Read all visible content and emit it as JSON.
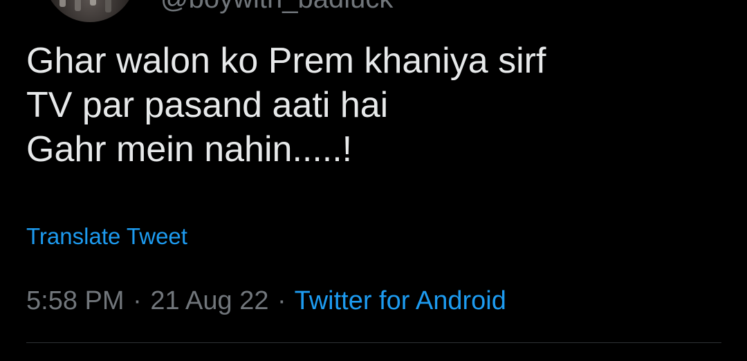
{
  "user": {
    "handle": "@boywith_badluck"
  },
  "tweet": {
    "lines": [
      "Ghar walon ko Prem khaniya sirf",
      "TV par pasand aati hai",
      "Gahr mein nahin.....!"
    ],
    "translate_label": "Translate Tweet",
    "time": "5:58 PM",
    "separator": "·",
    "date": "21 Aug 22",
    "source": "Twitter for Android"
  },
  "colors": {
    "background": "#000000",
    "text": "#e7e9ea",
    "muted": "#71767b",
    "accent": "#1d9bf0",
    "divider": "#2f3336"
  }
}
